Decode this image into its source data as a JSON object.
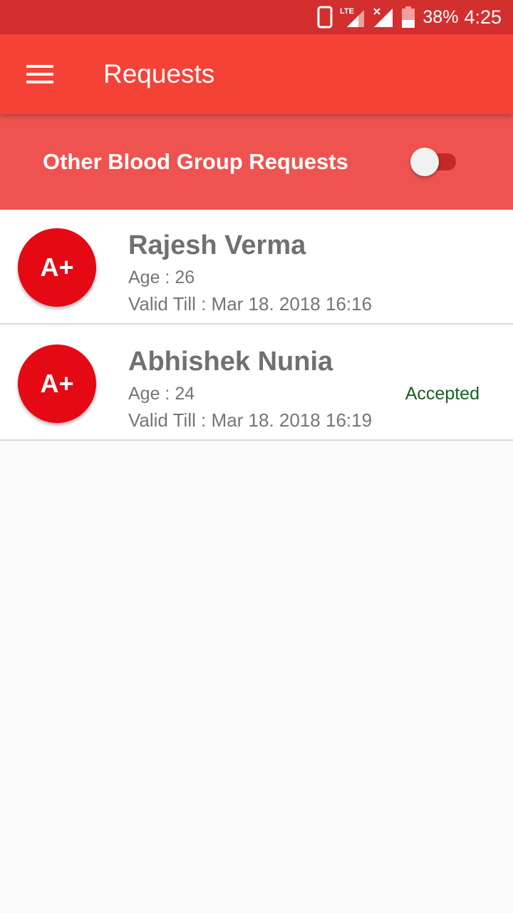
{
  "status_bar": {
    "battery_percent": "38%",
    "time": "4:25",
    "network_label": "LTE",
    "icons": [
      "phone-icon",
      "lte-signal-icon",
      "no-signal-icon",
      "battery-icon"
    ]
  },
  "toolbar": {
    "title": "Requests",
    "menu_icon": "hamburger-menu-icon"
  },
  "filter": {
    "label": "Other Blood Group Requests",
    "toggle_on": false
  },
  "requests": [
    {
      "blood_group": "A+",
      "name": "Rajesh Verma",
      "age": "Age : 26",
      "valid_till": "Valid Till : Mar 18. 2018 16:16",
      "status": ""
    },
    {
      "blood_group": "A+",
      "name": "Abhishek Nunia",
      "age": "Age : 24",
      "valid_till": "Valid Till : Mar 18. 2018 16:19",
      "status": "Accepted"
    }
  ],
  "colors": {
    "status_bar": "#d32f2f",
    "toolbar": "#f44336",
    "filter_bar": "#ef5350",
    "avatar": "#e50914",
    "accepted_text": "#1b5e20"
  }
}
